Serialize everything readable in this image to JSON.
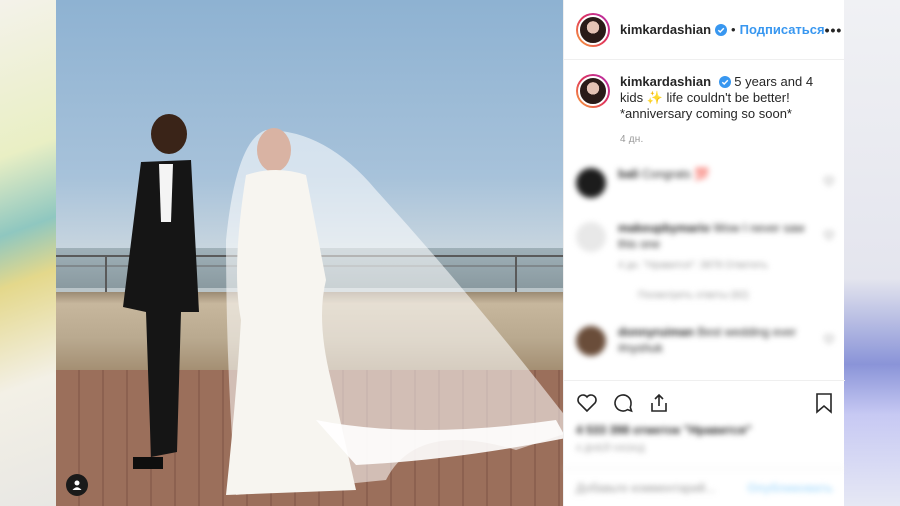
{
  "header": {
    "username": "kimkardashian",
    "follow_label": "Подписаться",
    "dot": "•",
    "more_label": "•••"
  },
  "caption": {
    "username": "kimkardashian",
    "text": "5 years and 4 kids ✨ life couldn't be better! *anniversary coming so soon*",
    "time": "4 дн."
  },
  "comments": [
    {
      "username": "bali",
      "text": "Congrats 💯",
      "avatar_color": "#1c1c1c"
    },
    {
      "username": "makeupbymario",
      "text": "Wow I never saw this one",
      "meta": "4 дн.   \"Нравится\": 3878   Ответить",
      "avatar_color": "#e8e8e8"
    },
    {
      "username": "",
      "text": "Посмотреть ответы (82)",
      "avatar_color": ""
    },
    {
      "username": "donnyruiman",
      "text": "Best wedding ever #nyshuk",
      "avatar_color": "#6a4d3a"
    }
  ],
  "actions": {
    "likes": "4 533 398 отметок \"Нравится\"",
    "date": "4 ДНЕЙ НАЗАД"
  },
  "add_comment": {
    "placeholder": "Добавьте комментарий...",
    "post_label": "Опубликовать"
  },
  "colors": {
    "link": "#3897f0",
    "verified": "#3897f0",
    "muted": "#999999"
  }
}
